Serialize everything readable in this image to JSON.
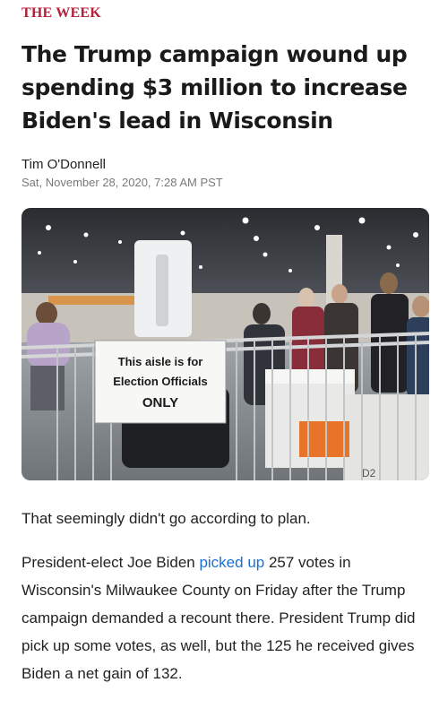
{
  "publisher": {
    "name": "THE WEEK"
  },
  "article": {
    "headline": "The Trump campaign wound up spending $3 million to increase Biden's lead in Wisconsin",
    "author": "Tim O'Donnell",
    "date": "Sat, November 28, 2020, 7:28 AM PST"
  },
  "photo": {
    "sign_lines": [
      "This aisle is for",
      "Election Officials",
      "ONLY"
    ],
    "box_marking": "D2"
  },
  "body": {
    "p1": "That seemingly didn't go according to plan.",
    "p2_before": "President-elect Joe Biden ",
    "p2_link": "picked up",
    "p2_after": " 257 votes in Wisconsin's Milwaukee County on Friday after the Trump campaign demanded a recount there. President Trump did pick up some votes, as well, but the 125 he received gives Biden a net gain of 132."
  },
  "colors": {
    "brand": "#b3203a",
    "link": "#1a6fd4"
  }
}
